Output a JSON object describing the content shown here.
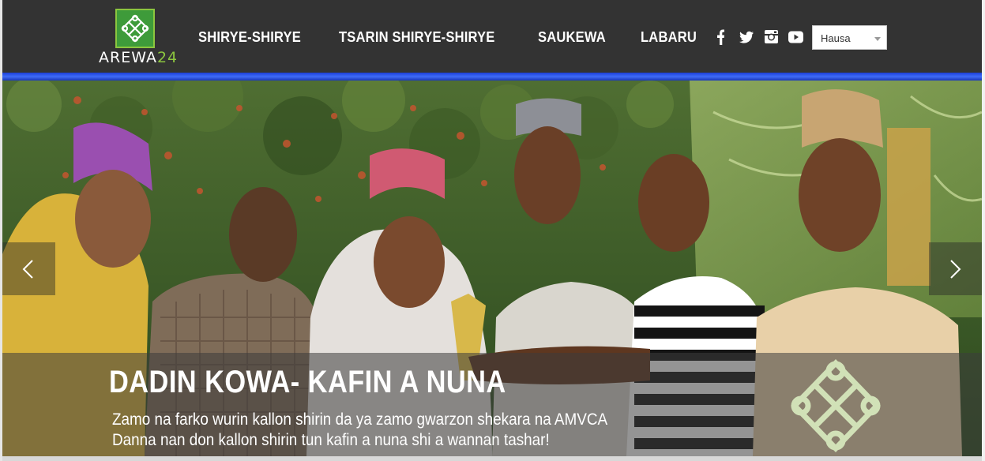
{
  "brand": {
    "logo_text": "AREWA",
    "logo_number": "24"
  },
  "nav": {
    "items": [
      {
        "label": "SHIRYE-SHIRYE"
      },
      {
        "label": "TSARIN SHIRYE-SHIRYE"
      },
      {
        "label": "SAUKEWA"
      },
      {
        "label": "LABARU"
      }
    ]
  },
  "social": {
    "icons": [
      "facebook-icon",
      "twitter-icon",
      "instagram-icon",
      "youtube-icon"
    ]
  },
  "language": {
    "selected": "Hausa"
  },
  "hero": {
    "title": "DADIN KOWA- KAFIN A NUNA",
    "line1": "Zamo na farko wurin kallon shirin da ya zamo gwarzon shekara na AMVCA",
    "line2": "Danna nan don kallon shirin tun kafin a nuna shi a wannan tashar!"
  },
  "colors": {
    "header_bg": "#333333",
    "accent_blue": "#2f56e8",
    "brand_green": "#3e9b3a"
  }
}
